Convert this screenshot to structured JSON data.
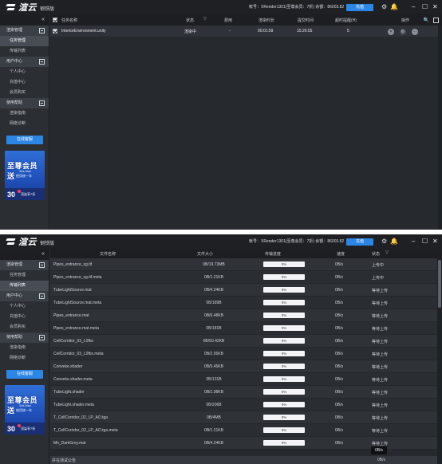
{
  "app": {
    "logo_text": "渲云",
    "edition": "钢铁版",
    "account_label": "帐号：XRender1301(至尊会员：7折)  余额：86003.82",
    "recharge": "充值"
  },
  "sidebar": {
    "groups": [
      {
        "title": "渲染管理",
        "items": [
          "任务管理",
          "传输列表"
        ]
      },
      {
        "title": "用户中心",
        "items": [
          "个人中心",
          "充值中心",
          "会员购买"
        ]
      },
      {
        "title": "使用帮助",
        "items": [
          "渲染指南",
          "网络诊断"
        ]
      }
    ],
    "online_service": "在线客服",
    "promo": {
      "title": "至尊会员送",
      "sub1": "3ds Max",
      "sub2": "使用统一年",
      "big": "30",
      "deal": "渲染享7折"
    }
  },
  "task_table": {
    "headers": {
      "name": "任务名称",
      "status": "状态",
      "cost": "费用",
      "render_time": "渲染时长",
      "submit_time": "提交时间",
      "timeout": "超时提醒(H)",
      "actions": "操作"
    },
    "rows": [
      {
        "name": "InteriorEnvironment.unity",
        "status": "渲染中",
        "cost": "-",
        "render_time": "00:01:59",
        "submit_time": "15:26:55",
        "timeout": "5"
      }
    ]
  },
  "transfer_table": {
    "headers": {
      "name": "文件名称",
      "size": "文件大小",
      "progress": "传输进度",
      "speed": "速度",
      "status": "状态"
    },
    "rows": [
      {
        "name": "Pipes_entrance_sg.tif",
        "size": "0B/19.73MB",
        "progress": "0%",
        "speed": "0B/s",
        "status": "上传中"
      },
      {
        "name": "Pipes_entrance_sg.tif.meta",
        "size": "0B/1.21KB",
        "progress": "0%",
        "speed": "0B/s",
        "status": "上传中"
      },
      {
        "name": "TubeLightSource.mat",
        "size": "0B/4.24KB",
        "progress": "0%",
        "speed": "0B/s",
        "status": "等待上传"
      },
      {
        "name": "TubeLightSource.mat.meta",
        "size": "0B/189B",
        "progress": "0%",
        "speed": "0B/s",
        "status": "等待上传"
      },
      {
        "name": "Pipes_entrance.mat",
        "size": "0B/6.48KB",
        "progress": "0%",
        "speed": "0B/s",
        "status": "等待上传"
      },
      {
        "name": "Pipes_entrance.mat.meta",
        "size": "0B/181B",
        "progress": "0%",
        "speed": "0B/s",
        "status": "等待上传"
      },
      {
        "name": "CellCorridor_03_L0fbx",
        "size": "0B/50.42KB",
        "progress": "0%",
        "speed": "0B/s",
        "status": "等待上传"
      },
      {
        "name": "CellCorridor_03_L0fbx.meta",
        "size": "0B/2.55KB",
        "progress": "0%",
        "speed": "0B/s",
        "status": "等待上传"
      },
      {
        "name": "Conveke.shader",
        "size": "0B/5.45KB",
        "progress": "0%",
        "speed": "0B/s",
        "status": "等待上传"
      },
      {
        "name": "Conveke.shader.meta",
        "size": "0B/131B",
        "progress": "0%",
        "speed": "0B/s",
        "status": "等待上传"
      },
      {
        "name": "TubeLight.shader",
        "size": "0B/1.98KB",
        "progress": "0%",
        "speed": "0B/s",
        "status": "等待上传"
      },
      {
        "name": "TubeLight.shader.meta",
        "size": "0B/206B",
        "progress": "0%",
        "speed": "0B/s",
        "status": "等待上传"
      },
      {
        "name": "T_CellCorridor_02_LP_AO.tga",
        "size": "0B/4MB",
        "progress": "0%",
        "speed": "0B/s",
        "status": "等待上传"
      },
      {
        "name": "T_CellCorridor_02_LP_AO.tga.meta",
        "size": "0B/1.21KB",
        "progress": "0%",
        "speed": "0B/s",
        "status": "等待上传"
      },
      {
        "name": "Mn_DarkGrey.mat",
        "size": "0B/4.24KB",
        "progress": "0%",
        "speed": "0B/s",
        "status": "等待上传"
      }
    ],
    "tooltip_speed": "0B/s",
    "footer_label": "并在测试公告",
    "footer_speed": "0B/s"
  }
}
